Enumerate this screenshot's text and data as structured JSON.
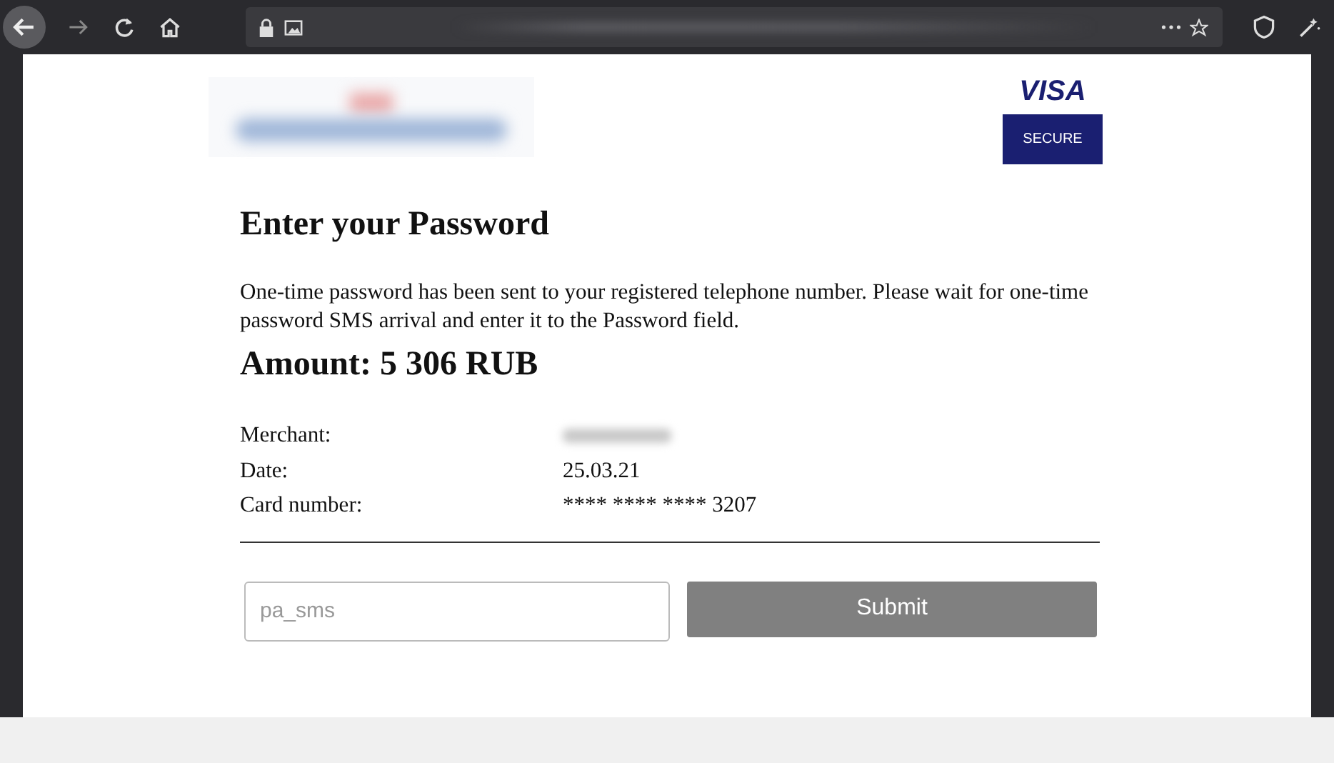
{
  "page": {
    "brand": "VISA",
    "badge": "SECURE",
    "heading": "Enter your Password",
    "message": "One-time password has been sent to your registered telephone number. Please wait for one-time password SMS arrival and enter it to the Password field.",
    "amount": "Amount: 5 306 RUB",
    "details": [
      {
        "label": "Merchant:"
      },
      {
        "label": "Date:",
        "value": "25.03.21"
      },
      {
        "label": "Card number:",
        "value": "**** **** **** 3207"
      }
    ],
    "password_field": {
      "placeholder": "pa_sms"
    },
    "submit": "Submit"
  }
}
